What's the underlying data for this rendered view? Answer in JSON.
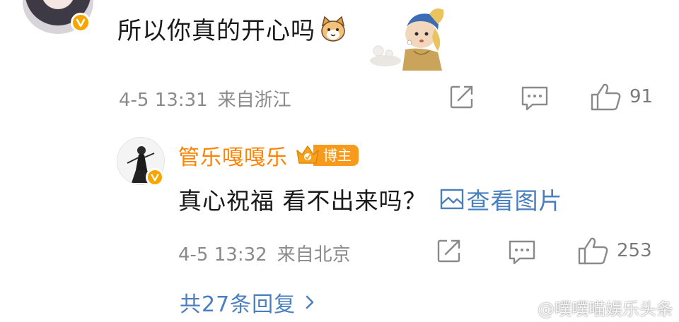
{
  "comment": {
    "text": "所以你真的开心吗",
    "timestamp": "4-5 13:31",
    "location": "来自浙江",
    "like_count": "91"
  },
  "reply": {
    "username": "管乐嘎嘎乐",
    "badge_label": "博主",
    "text": "真心祝福 看不出来吗？",
    "view_image_label": "查看图片",
    "timestamp": "4-5 13:32",
    "location": "来自北京",
    "like_count": "253"
  },
  "more_replies_label": "共27条回复",
  "watermark_text": "@噗噗喵娱乐头条",
  "colors": {
    "username": "#ff8200",
    "link": "#4a7fbf",
    "meta_text": "#8a8a8a",
    "verified_badge": "#f7a600"
  },
  "icons": {
    "repost": "share-icon",
    "comment": "comment-icon",
    "like": "thumbs-up-icon",
    "picture": "image-icon",
    "chevron": "chevron-right-icon",
    "verified": "verified-v-icon",
    "crown": "crown-icon"
  }
}
